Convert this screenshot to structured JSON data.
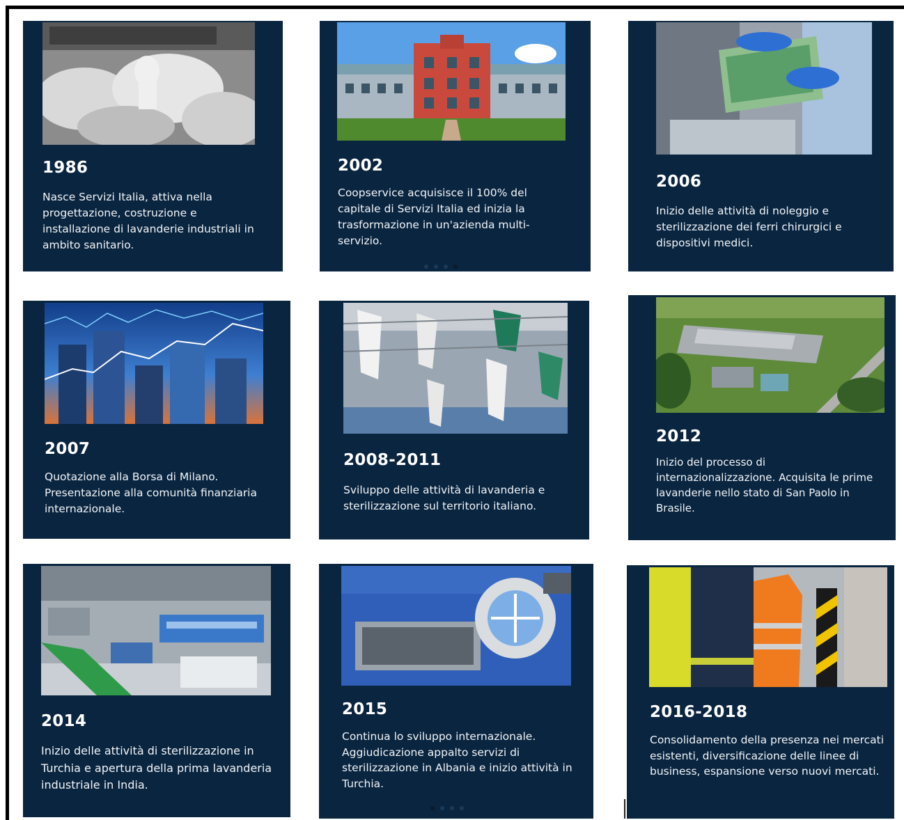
{
  "timeline": [
    {
      "year": "1986",
      "text": "Nasce Servizi Italia, attiva nella progettazione, costruzione e installazione di lavanderie industriali in ambito sanitario.",
      "image": "laundry-workers-bw"
    },
    {
      "year": "2002",
      "text": "Coopservice acquisisce il 100% del capitale di Servizi Italia ed inizia la trasformazione in un'azienda multi-servizio.",
      "image": "headquarters-building"
    },
    {
      "year": "2006",
      "text": "Inizio delle attività di noleggio e sterilizzazione dei ferri chirurgici e dispositivi medici.",
      "image": "gloved-hands-surgical-tray"
    },
    {
      "year": "2007",
      "text": "Quotazione alla Borsa di Milano. Presentazione alla comunità finanziaria internazionale.",
      "image": "stock-chart-skyscrapers"
    },
    {
      "year": "2008-2011",
      "text": "Sviluppo delle attività di lavanderia e sterilizzazione sul territorio italiano.",
      "image": "hanging-garments-conveyor"
    },
    {
      "year": "2012",
      "text": "Inizio del processo di internazionalizzazione. Acquisita le prime lavanderie nello stato di San Paolo in Brasile.",
      "image": "aerial-industrial-plant"
    },
    {
      "year": "2014",
      "text": "Inizio delle attività di sterilizzazione in Turchia e apertura della prima lavanderia industriale in India.",
      "image": "sterilization-facility-interior"
    },
    {
      "year": "2015",
      "text": "Continua lo sviluppo internazionale. Aggiudicazione appalto servizi di sterilizzazione in Albania e inizio attività in Turchia.",
      "image": "surgical-instruments-magnifier"
    },
    {
      "year": "2016-2018",
      "text": "Consolidamento della presenza nei mercati esistenti, diversificazione delle linee di business, espansione verso nuovi mercati.",
      "image": "workwear-hi-vis-jackets"
    }
  ],
  "colors": {
    "card_bg": "#0a2540",
    "text": "#ffffff"
  }
}
